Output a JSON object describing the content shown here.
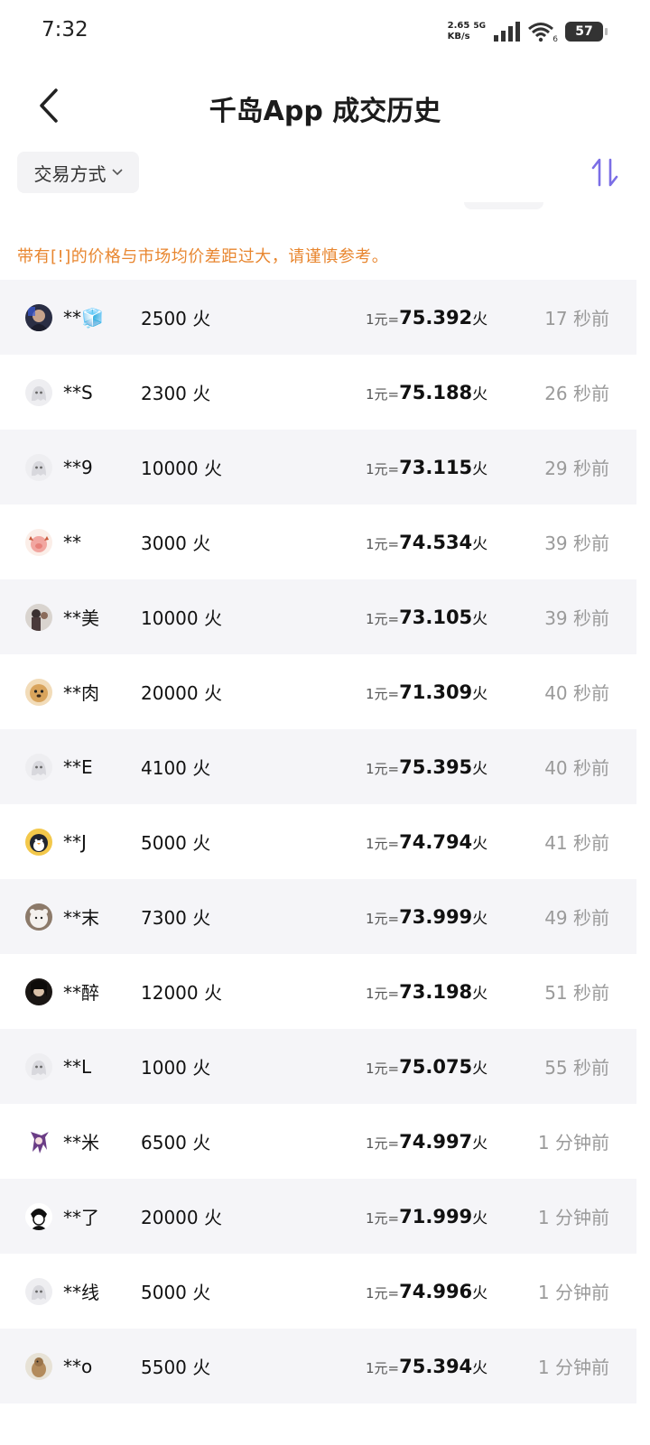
{
  "status": {
    "time": "7:32",
    "speed_value": "2.65",
    "speed_unit": "KB/s",
    "network": "5G",
    "wifi_level": "6",
    "battery": "57"
  },
  "header": {
    "title": "千岛App 成交历史",
    "back_icon": "chevron-left-icon"
  },
  "filter": {
    "label": "交易方式",
    "sort_icon": "sort-arrows-icon",
    "accent": "#7b6ee6"
  },
  "warning": {
    "text": "带有[!]的价格与市场均价差距过大，请谨慎参考。",
    "color": "#e8862f"
  },
  "rate_prefix": "1元=",
  "rate_unit": "火",
  "records": [
    {
      "user": "**🧊",
      "amount": "2500 火",
      "rate": "75.392",
      "time": "17 秒前",
      "avatar": "dark"
    },
    {
      "user": "**S",
      "amount": "2300 火",
      "rate": "75.188",
      "time": "26 秒前",
      "avatar": "ghost"
    },
    {
      "user": "**9",
      "amount": "10000 火",
      "rate": "73.115",
      "time": "29 秒前",
      "avatar": "ghost"
    },
    {
      "user": "**",
      "amount": "3000 火",
      "rate": "74.534",
      "time": "39 秒前",
      "avatar": "pig"
    },
    {
      "user": "**美",
      "amount": "10000 火",
      "rate": "73.105",
      "time": "39 秒前",
      "avatar": "photo"
    },
    {
      "user": "**肉",
      "amount": "20000 火",
      "rate": "71.309",
      "time": "40 秒前",
      "avatar": "dog"
    },
    {
      "user": "**E",
      "amount": "4100 火",
      "rate": "75.395",
      "time": "40 秒前",
      "avatar": "ghost"
    },
    {
      "user": "**J",
      "amount": "5000 火",
      "rate": "74.794",
      "time": "41 秒前",
      "avatar": "penguin"
    },
    {
      "user": "**末",
      "amount": "7300 火",
      "rate": "73.999",
      "time": "49 秒前",
      "avatar": "bear"
    },
    {
      "user": "**醉",
      "amount": "12000 火",
      "rate": "73.198",
      "time": "51 秒前",
      "avatar": "dark2"
    },
    {
      "user": "**L",
      "amount": "1000 火",
      "rate": "75.075",
      "time": "55 秒前",
      "avatar": "ghost"
    },
    {
      "user": "**米",
      "amount": "6500 火",
      "rate": "74.997",
      "time": "1 分钟前",
      "avatar": "anime"
    },
    {
      "user": "**了",
      "amount": "20000 火",
      "rate": "71.999",
      "time": "1 分钟前",
      "avatar": "sketch"
    },
    {
      "user": "**线",
      "amount": "5000 火",
      "rate": "74.996",
      "time": "1 分钟前",
      "avatar": "ghost"
    },
    {
      "user": "**o",
      "amount": "5500 火",
      "rate": "75.394",
      "time": "1 分钟前",
      "avatar": "bird"
    }
  ]
}
